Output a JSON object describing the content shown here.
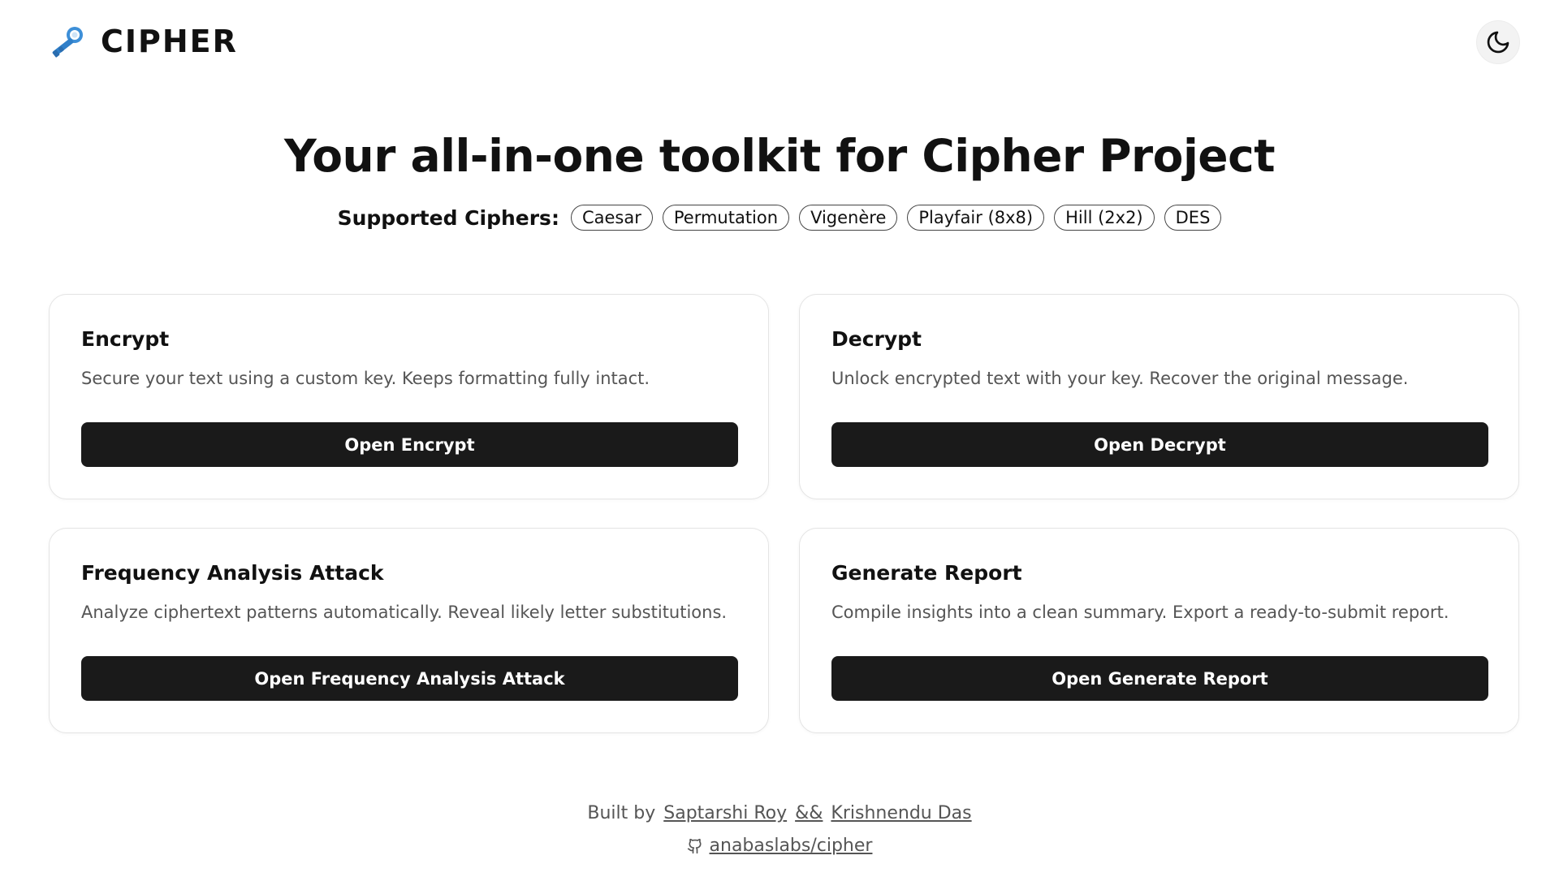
{
  "header": {
    "brand": "CIPHER",
    "brand_icon": "key-icon",
    "theme_toggle_icon": "moon-icon"
  },
  "hero": {
    "title": "Your all-in-one toolkit for Cipher Project",
    "ciphers_label": "Supported Ciphers:",
    "ciphers": [
      "Caesar",
      "Permutation",
      "Vigenère",
      "Playfair (8x8)",
      "Hill (2x2)",
      "DES"
    ]
  },
  "cards": [
    {
      "title": "Encrypt",
      "description": "Secure your text using a custom key. Keeps formatting fully intact.",
      "button": "Open Encrypt"
    },
    {
      "title": "Decrypt",
      "description": "Unlock encrypted text with your key. Recover the original message.",
      "button": "Open Decrypt"
    },
    {
      "title": "Frequency Analysis Attack",
      "description": "Analyze ciphertext patterns automatically. Reveal likely letter substitutions.",
      "button": "Open Frequency Analysis Attack"
    },
    {
      "title": "Generate Report",
      "description": "Compile insights into a clean summary. Export a ready-to-submit report.",
      "button": "Open Generate Report"
    }
  ],
  "footer": {
    "built_by": "Built by",
    "author1": "Saptarshi Roy",
    "separator": "&&",
    "author2": "Krishnendu Das",
    "repo_icon": "github-icon",
    "repo": "anabaslabs/cipher"
  },
  "colors": {
    "button_bg": "#1a1a1a",
    "card_border": "#e4e4e4",
    "text_muted": "#555555",
    "key_blue": "#3d8fd8"
  }
}
